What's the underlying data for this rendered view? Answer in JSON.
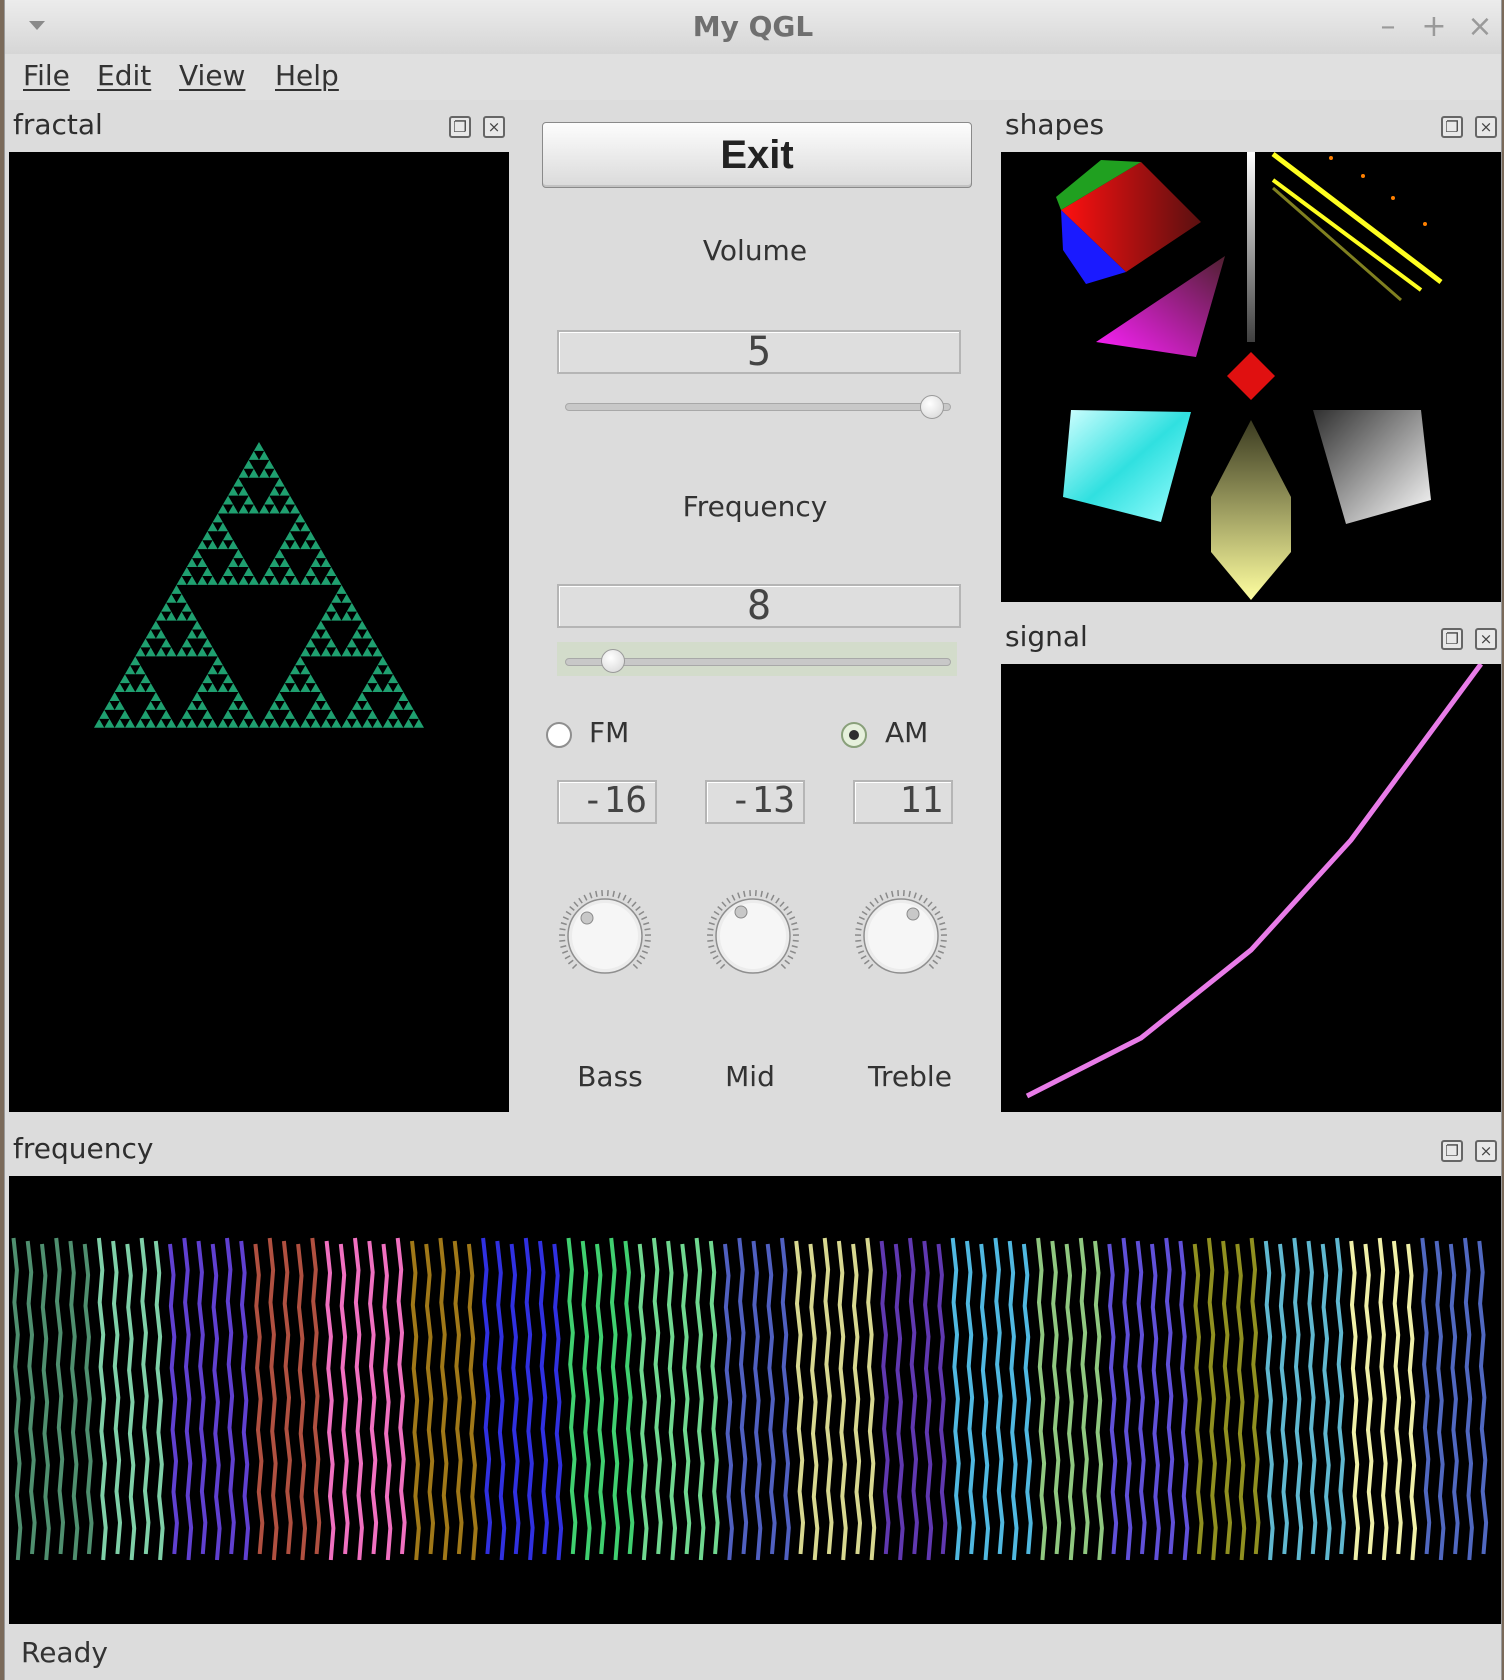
{
  "window": {
    "title": "My QGL"
  },
  "menubar": {
    "items": [
      "File",
      "Edit",
      "View",
      "Help"
    ]
  },
  "docks": {
    "fractal": {
      "title": "fractal"
    },
    "shapes": {
      "title": "shapes"
    },
    "signal": {
      "title": "signal"
    },
    "frequency": {
      "title": "frequency"
    }
  },
  "controls": {
    "exit_label": "Exit",
    "volume": {
      "label": "Volume",
      "value": 5,
      "slider_fraction": 0.98
    },
    "frequency": {
      "label": "Frequency",
      "value": 8,
      "slider_fraction": 0.1
    },
    "modulation": {
      "options": [
        "FM",
        "AM"
      ],
      "selected": "AM"
    },
    "lcd_values": [
      "-16",
      "-13",
      "11"
    ],
    "dials": [
      "Bass",
      "Mid",
      "Treble"
    ]
  },
  "status": {
    "text": "Ready"
  },
  "colors": {
    "fractal_green": "#1fa070",
    "signal_curve": "#e87ce8",
    "wave_palette": [
      "#4f8f6f",
      "#7fd0a8",
      "#6040d0",
      "#b05040",
      "#f070c0",
      "#a07818",
      "#3030e0",
      "#40d070",
      "#70d890",
      "#5060c0",
      "#d8d890",
      "#6038b0",
      "#50b8e0",
      "#90c880",
      "#6050d8",
      "#909020",
      "#60b8d0",
      "#f0f0a8",
      "#5068c0"
    ]
  }
}
